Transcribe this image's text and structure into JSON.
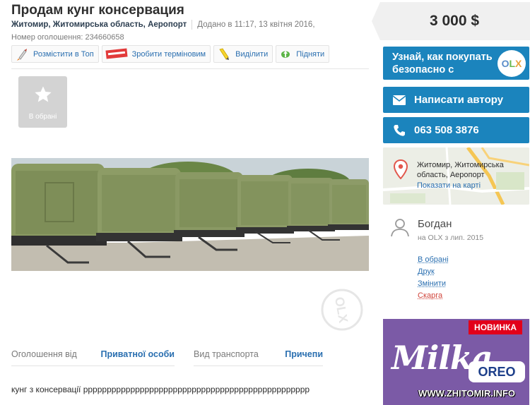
{
  "listing": {
    "title": "Продам кунг консервация",
    "location": "Житомир, Житомирська область, Аеропорт",
    "added": "Додано в 11:17, 13 квітня 2016,",
    "ad_number": "Номер оголошення: 234660658"
  },
  "actions": [
    {
      "label": "Розмістити в Топ",
      "icon": "rocket-icon"
    },
    {
      "label": "Зробити терміновим",
      "icon": "urgent-sticker-icon"
    },
    {
      "label": "Виділити",
      "icon": "highlighter-icon"
    },
    {
      "label": "Підняти",
      "icon": "up-arrow-icon"
    }
  ],
  "gallery": {
    "favorite_label": "В обрані",
    "watermark": "OLX"
  },
  "details": [
    {
      "key": "Оголошення від",
      "value": "Приватної особи"
    },
    {
      "key": "Вид транспорта",
      "value": "Причепи"
    }
  ],
  "description": "кунг з консервації рррррррррррррррррррррррррррррррррррррррррррррррр",
  "sidebar": {
    "price": "3 000 $",
    "olx_safe": "Узнай, как покупать безопасно с",
    "olx_logo": {
      "o": "O",
      "l": "L",
      "x": "X"
    },
    "write_author": "Написати автору",
    "phone": "063 508 3876",
    "map_address": "Житомир, Житомирська область, Аеропорт",
    "map_link": "Показати на карті"
  },
  "user": {
    "name": "Богдан",
    "since": "на OLX з лип. 2015",
    "links": [
      "В обрані",
      "Друк",
      "Змінити",
      "Скарга"
    ]
  },
  "banner": {
    "badge": "НОВИНКА",
    "brand": "Milka",
    "oreo": "OREO",
    "site": "WWW.ZHITOMIR.INFO"
  },
  "colors": {
    "accent_blue": "#1b84bd",
    "link_blue": "#2a6fb0",
    "report_red": "#d0443a",
    "banner_purple": "#7b5aa6"
  }
}
